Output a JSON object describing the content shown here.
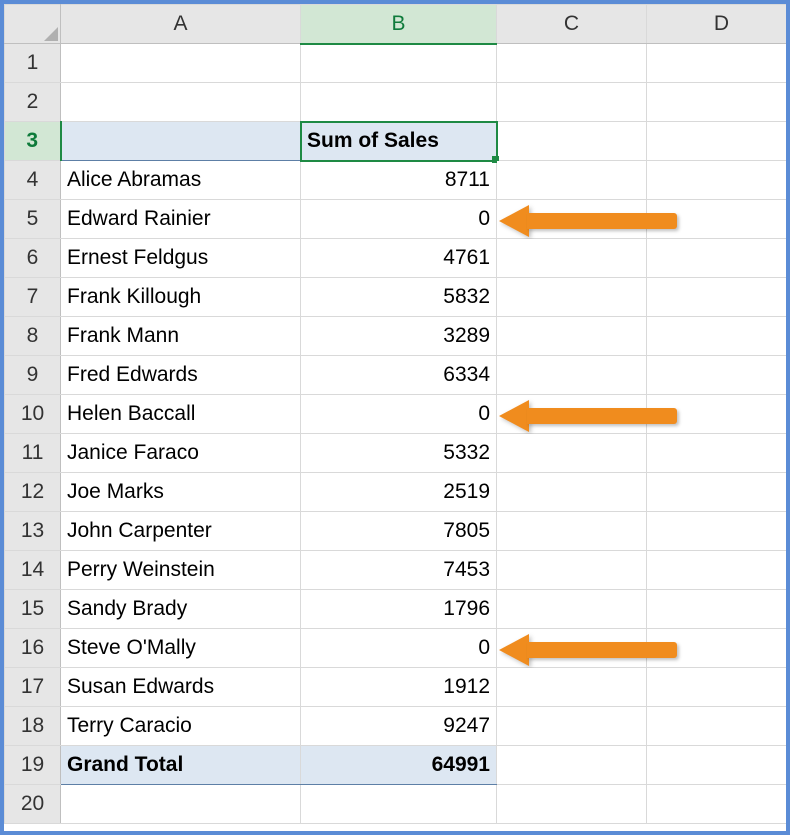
{
  "columns": [
    "A",
    "B",
    "C",
    "D"
  ],
  "selected_column_index": 1,
  "selected_row_index": 2,
  "row_numbers": [
    "1",
    "2",
    "3",
    "4",
    "5",
    "6",
    "7",
    "8",
    "9",
    "10",
    "11",
    "12",
    "13",
    "14",
    "15",
    "16",
    "17",
    "18",
    "19",
    "20"
  ],
  "pivot": {
    "header_B": "Sum of Sales",
    "rows": [
      {
        "name": "Alice Abramas",
        "value": "8711",
        "arrow": false
      },
      {
        "name": "Edward Rainier",
        "value": "0",
        "arrow": true
      },
      {
        "name": "Ernest Feldgus",
        "value": "4761",
        "arrow": false
      },
      {
        "name": "Frank Killough",
        "value": "5832",
        "arrow": false
      },
      {
        "name": "Frank Mann",
        "value": "3289",
        "arrow": false
      },
      {
        "name": "Fred Edwards",
        "value": "6334",
        "arrow": false
      },
      {
        "name": "Helen Baccall",
        "value": "0",
        "arrow": true
      },
      {
        "name": "Janice Faraco",
        "value": "5332",
        "arrow": false
      },
      {
        "name": "Joe Marks",
        "value": "2519",
        "arrow": false
      },
      {
        "name": "John Carpenter",
        "value": "7805",
        "arrow": false
      },
      {
        "name": "Perry Weinstein",
        "value": "7453",
        "arrow": false
      },
      {
        "name": "Sandy Brady",
        "value": "1796",
        "arrow": false
      },
      {
        "name": "Steve O'Mally",
        "value": "0",
        "arrow": true
      },
      {
        "name": "Susan Edwards",
        "value": "1912",
        "arrow": false
      },
      {
        "name": "Terry Caracio",
        "value": "9247",
        "arrow": false
      }
    ],
    "total_label": "Grand Total",
    "total_value": "64991"
  }
}
